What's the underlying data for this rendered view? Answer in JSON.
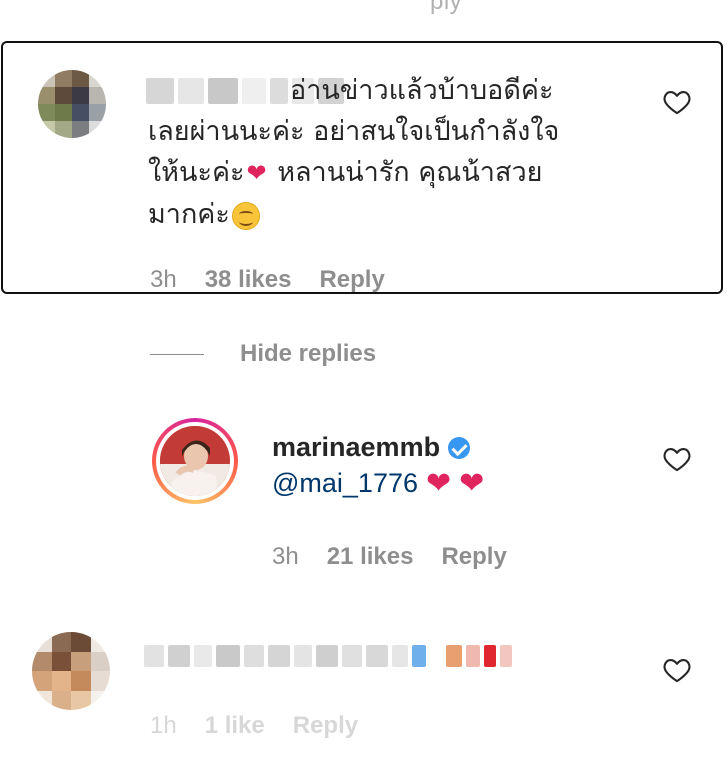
{
  "top_fragment": "ply",
  "comments": [
    {
      "text_line1": "อ่านข่าวแล้วบ้าบอดีค่ะ",
      "text_line2": "เลยผ่านนะค่ะ อย่าสนใจเป็นกำลังใจ",
      "text_line3_a": "ให้นะค่ะ",
      "text_line3_b": "หลานน่ารัก คุณน้าสวย",
      "text_line4": "มากค่ะ",
      "heart_emoji": "❤",
      "time": "3h",
      "likes": "38 likes",
      "reply": "Reply"
    }
  ],
  "thread": {
    "hide_replies": "Hide replies"
  },
  "reply": {
    "username": "marinaemmb",
    "mention": "@mai_1776",
    "hearts": [
      "❤",
      "❤"
    ],
    "time": "3h",
    "likes": "21 likes",
    "reply": "Reply"
  },
  "bottom_comment": {
    "time": "1h",
    "likes": "1 like",
    "reply": "Reply"
  },
  "icons": {
    "like": "heart-outline-icon",
    "verified": "verified-badge-icon"
  },
  "colors": {
    "text": "#262626",
    "muted": "#8e8e8e",
    "link": "#00376b",
    "verified": "#3897f0",
    "heart": "#e0245e",
    "highlight_border": "#111111"
  }
}
